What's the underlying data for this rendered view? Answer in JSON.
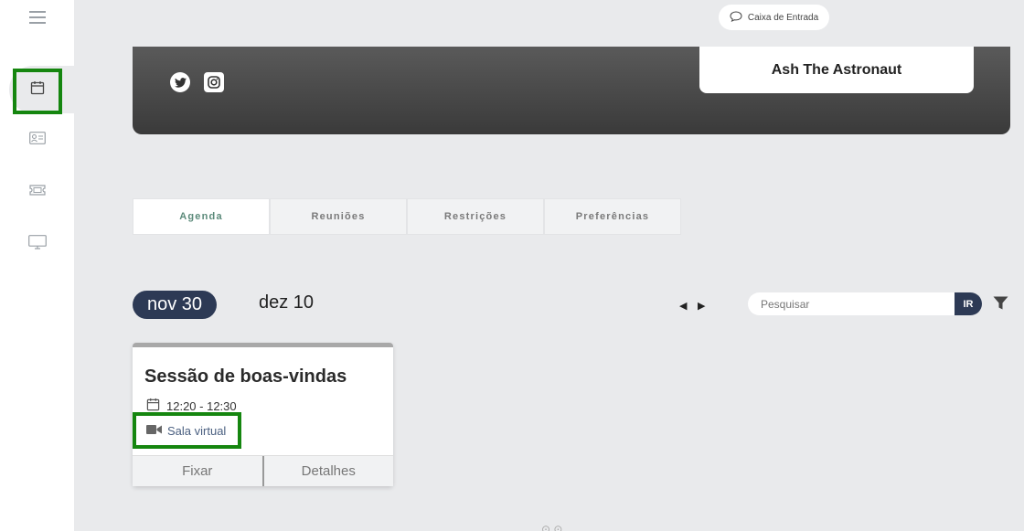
{
  "sidebar": {
    "icons": [
      "menu-icon",
      "calendar-icon",
      "id-card-icon",
      "ticket-icon",
      "monitor-icon"
    ]
  },
  "header": {
    "inbox_label": "Caixa de Entrada",
    "profile_name": "Ash The Astronaut",
    "social": [
      "twitter-icon",
      "instagram-icon"
    ]
  },
  "tabs": [
    {
      "label": "Agenda",
      "active": true
    },
    {
      "label": "Reuniões",
      "active": false
    },
    {
      "label": "Restrições",
      "active": false
    },
    {
      "label": "Preferências",
      "active": false
    }
  ],
  "dates": {
    "selected": "nov 30",
    "other": "dez 10"
  },
  "search": {
    "placeholder": "Pesquisar",
    "button_label": "IR"
  },
  "session": {
    "title": "Sessão de boas-vindas",
    "time": "12:20 - 12:30",
    "room": "Sala virtual",
    "pin_label": "Fixar",
    "details_label": "Detalhes"
  },
  "colors": {
    "accent_navy": "#2d3a55",
    "highlight_green": "#15860f",
    "active_tab_text": "#5b8a7a"
  }
}
